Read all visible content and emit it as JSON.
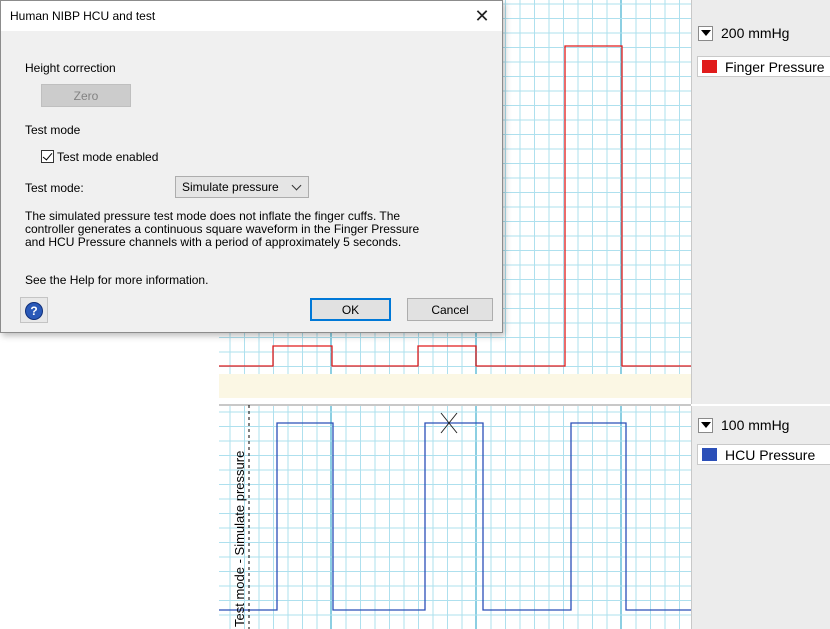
{
  "dialog": {
    "title": "Human NIBP HCU and test",
    "close_glyph": "✕",
    "height_correction_label": "Height correction",
    "zero_button": "Zero",
    "test_mode_section": "Test mode",
    "test_mode_enabled_label": "Test mode enabled",
    "test_mode_enabled_checked": true,
    "test_mode_field_label": "Test mode:",
    "test_mode_value": "Simulate pressure",
    "description_lines": [
      "The simulated pressure test mode does not inflate the finger cuffs. The",
      "controller generates a continuous square waveform in the Finger Pressure",
      "and HCU Pressure channels with a period of approximately 5 seconds."
    ],
    "help_text": "See the Help for more information.",
    "help_icon": "help-icon",
    "ok_button": "OK",
    "cancel_button": "Cancel"
  },
  "channels": [
    {
      "scale": "200 mmHg",
      "name": "Finger Pressure",
      "color": "#e01b1b"
    },
    {
      "scale": "100 mmHg",
      "name": "HCU Pressure",
      "color": "#2b4fb8"
    }
  ],
  "comment_label": "Test mode - Simulate pressure",
  "colors": {
    "grid_minor": "#aee0ee",
    "grid_major": "#8ccfe2",
    "finger_trace": "#e01b1b",
    "hcu_trace": "#2b4fb8",
    "band": "#fbf7e4",
    "panel": "#ececec"
  },
  "traces": {
    "finger_pressure": {
      "high_start": [
        273,
        565
      ],
      "high_end": [
        332,
        622
      ],
      "low_segments": [
        [
          219,
          273
        ],
        [
          332,
          418
        ],
        [
          476,
          565
        ],
        [
          622,
          691
        ]
      ],
      "mid_segments": [
        [
          418,
          476
        ]
      ]
    },
    "hcu_pressure": {
      "high_segments": [
        [
          277,
          333
        ],
        [
          425,
          483
        ],
        [
          571,
          626
        ]
      ],
      "low_segments": [
        [
          219,
          277
        ],
        [
          333,
          425
        ],
        [
          483,
          571
        ],
        [
          626,
          691
        ]
      ]
    }
  }
}
